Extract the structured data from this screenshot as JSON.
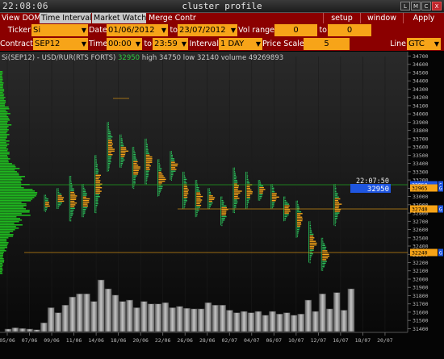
{
  "window": {
    "clock": "22:08:06",
    "title": "cluster profile",
    "buttons": [
      "L",
      "M",
      "C",
      "X"
    ]
  },
  "toolbar": {
    "tabs": [
      "View DOM",
      "Time Interval",
      "Market Watch",
      "Merge Contr"
    ],
    "right_buttons": [
      "setup",
      "window",
      "Apply"
    ]
  },
  "params": {
    "ticker_label": "Ticker",
    "ticker_value": "Si",
    "date_label": "Date",
    "date_from": "01/06/2012",
    "to_label": "to",
    "date_to": "23/07/2012",
    "vol_range_label": "Vol range",
    "vol_from": "0",
    "vol_to_label": "to",
    "vol_to": "0",
    "contract_label": "Contract",
    "contract_value": "SEP12",
    "time_label": "Time",
    "time_from": "00:00",
    "time_to_label": "to",
    "time_to": "23:59",
    "interval_label": "Interval",
    "interval_value": "1 DAY",
    "price_scale_label": "Price Scale",
    "price_scale_value": "5",
    "line_label": "Line",
    "line_value": "GTC"
  },
  "info": {
    "symbol": "Si(SEP12) - USD/RUR(RTS FORTS)",
    "last": "32950",
    "high": "high 34750",
    "low": "low 32140",
    "volume": "volume 49269893"
  },
  "chart_data": {
    "type": "cluster profile",
    "y_ticks": [
      31400,
      31500,
      31600,
      31700,
      31800,
      31900,
      32000,
      32100,
      32200,
      32300,
      32400,
      32500,
      32600,
      32700,
      32800,
      32900,
      33000,
      33100,
      33200,
      33300,
      33400,
      33500,
      33600,
      33700,
      33800,
      33900,
      34000,
      34100,
      34200,
      34300,
      34400,
      34500,
      34600,
      34700
    ],
    "x_ticks": [
      "05/06",
      "07/06",
      "09/06",
      "11/06",
      "14/06",
      "18/06",
      "20/06",
      "22/06",
      "26/06",
      "28/06",
      "02/07",
      "04/07",
      "06/07",
      "10/07",
      "12/07",
      "16/07",
      "18/07",
      "20/07"
    ],
    "crosshair": {
      "time": "22:07:50",
      "price": "32950"
    },
    "price_markers": [
      {
        "label": "32950",
        "color": "#1f56e0"
      },
      {
        "label": "32965",
        "color": "#f7a418"
      },
      {
        "label": "32740",
        "color": "#f7a418"
      },
      {
        "label": "32240",
        "color": "#f7a418"
      }
    ],
    "marker_tags": [
      "G",
      "G",
      "G",
      "G"
    ],
    "volume_bars": [
      0.04,
      0.06,
      0.05,
      0.04,
      0.03,
      0.14,
      0.38,
      0.3,
      0.42,
      0.55,
      0.6,
      0.6,
      0.48,
      0.82,
      0.68,
      0.58,
      0.48,
      0.5,
      0.38,
      0.48,
      0.44,
      0.44,
      0.46,
      0.38,
      0.4,
      0.37,
      0.36,
      0.36,
      0.46,
      0.42,
      0.42,
      0.34,
      0.3,
      0.32,
      0.3,
      0.32,
      0.26,
      0.32,
      0.28,
      0.3,
      0.26,
      0.28,
      0.5,
      0.32,
      0.6,
      0.36,
      0.62,
      0.34,
      0.68
    ]
  }
}
